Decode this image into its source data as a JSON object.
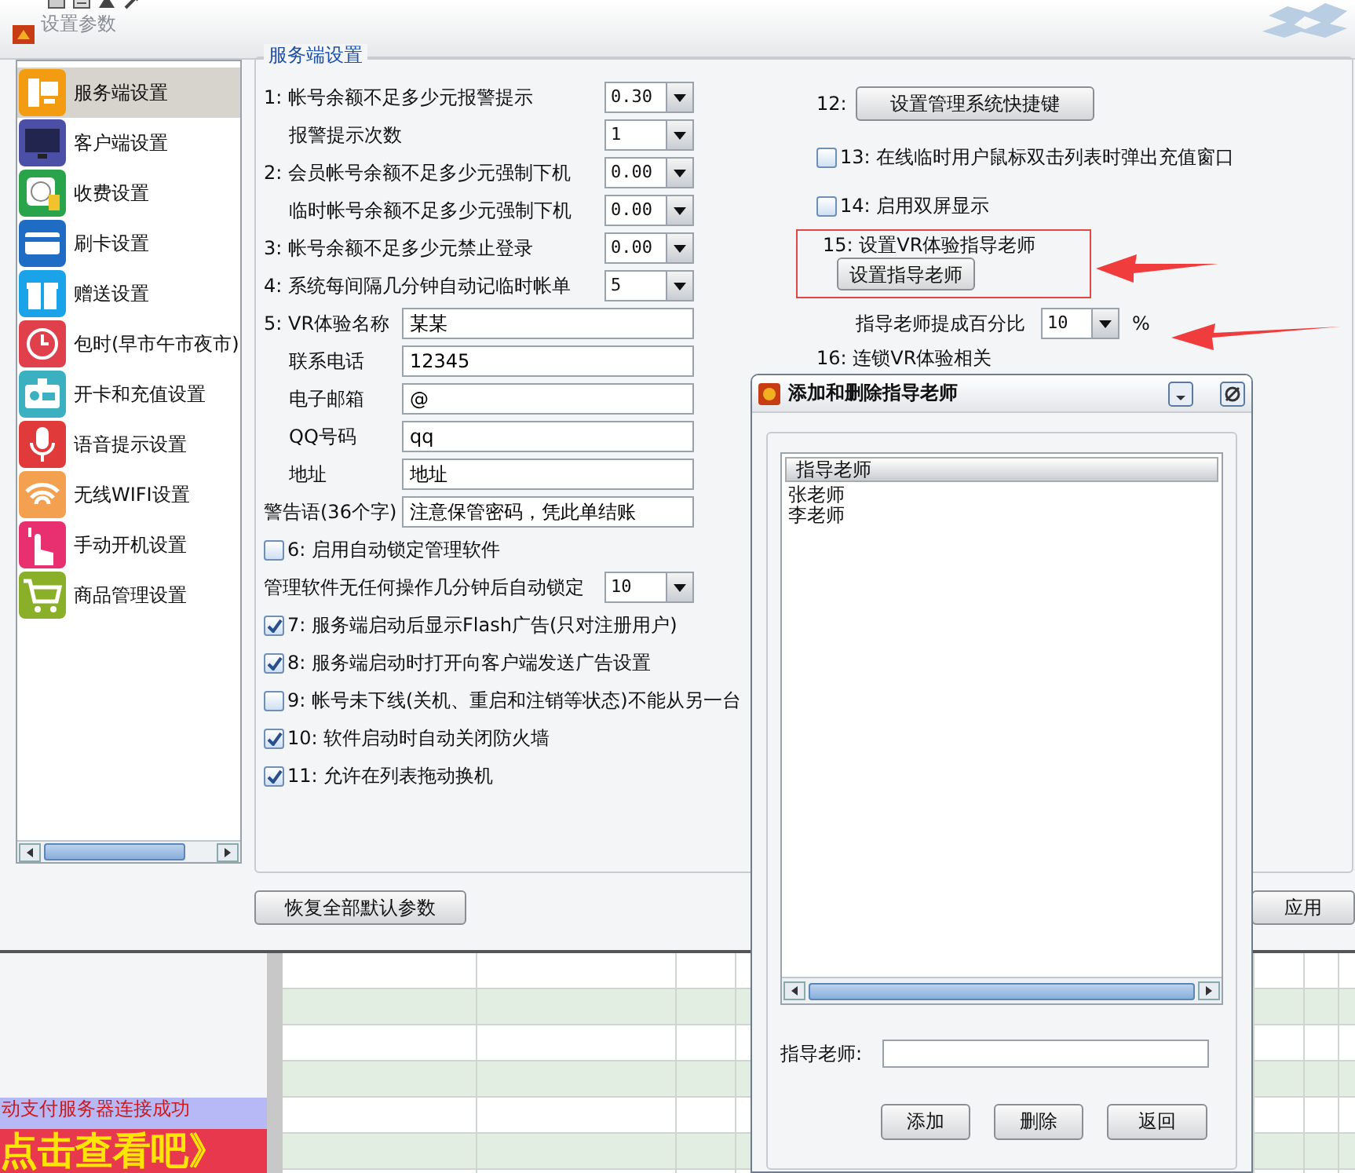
{
  "window": {
    "title": "设置参数"
  },
  "sidebar": {
    "items": [
      {
        "label": "服务端设置",
        "selected": true
      },
      {
        "label": "客户端设置",
        "selected": false
      },
      {
        "label": "收费设置",
        "selected": false
      },
      {
        "label": "刷卡设置",
        "selected": false
      },
      {
        "label": "赠送设置",
        "selected": false
      },
      {
        "label": "包时(早市午市夜市)",
        "selected": false
      },
      {
        "label": "开卡和充值设置",
        "selected": false
      },
      {
        "label": "语音提示设置",
        "selected": false
      },
      {
        "label": "无线WIFI设置",
        "selected": false
      },
      {
        "label": "手动开机设置",
        "selected": false
      },
      {
        "label": "商品管理设置",
        "selected": false
      }
    ]
  },
  "group": {
    "title": "服务端设置"
  },
  "left_rows": [
    {
      "kind": "select",
      "label": "1: 帐号余额不足多少元报警提示",
      "value": "0.30",
      "indented": false
    },
    {
      "kind": "select",
      "label": "报警提示次数",
      "value": "1",
      "indented": true
    },
    {
      "kind": "select",
      "label": "2: 会员帐号余额不足多少元强制下机",
      "value": "0.00",
      "indented": false
    },
    {
      "kind": "select",
      "label": "临时帐号余额不足多少元强制下机",
      "value": "0.00",
      "indented": true
    },
    {
      "kind": "select",
      "label": "3: 帐号余额不足多少元禁止登录",
      "value": "0.00",
      "indented": false
    },
    {
      "kind": "select",
      "label": "4: 系统每间隔几分钟自动记临时帐单",
      "value": "5",
      "indented": false
    },
    {
      "kind": "text",
      "label": "5: VR体验名称",
      "value": "某某",
      "indented": false
    },
    {
      "kind": "text",
      "label": "联系电话",
      "value": "12345",
      "indented": true
    },
    {
      "kind": "text",
      "label": "电子邮箱",
      "value": "@",
      "indented": true
    },
    {
      "kind": "text",
      "label": "QQ号码",
      "value": "qq",
      "indented": true
    },
    {
      "kind": "text",
      "label": "地址",
      "value": "地址",
      "indented": true
    },
    {
      "kind": "text",
      "label": "警告语(36个字)",
      "value": "注意保管密码，凭此单结账",
      "indented": false
    },
    {
      "kind": "checkbox",
      "label": "6: 启用自动锁定管理软件",
      "checked": false
    },
    {
      "kind": "select",
      "label": "管理软件无任何操作几分钟后自动锁定",
      "value": "10",
      "indented": false
    },
    {
      "kind": "checkbox",
      "label": "7: 服务端启动后显示Flash广告(只对注册用户)",
      "checked": true
    },
    {
      "kind": "checkbox",
      "label": "8: 服务端启动时打开向客户端发送广告设置",
      "checked": true
    },
    {
      "kind": "checkbox",
      "label": "9: 帐号未下线(关机、重启和注销等状态)不能从另一台",
      "checked": false
    },
    {
      "kind": "checkbox",
      "label": "10: 软件启动时自动关闭防火墙",
      "checked": true
    },
    {
      "kind": "checkbox",
      "label": "11: 允许在列表拖动换机",
      "checked": true
    }
  ],
  "right_rows": [
    {
      "kind": "button",
      "label": "12:",
      "button": "设置管理系统快捷键"
    },
    {
      "kind": "checkbox",
      "label": "13: 在线临时用户鼠标双击列表时弹出充值窗口",
      "checked": false
    },
    {
      "kind": "checkbox",
      "label": "14: 启用双屏显示",
      "checked": false
    },
    {
      "kind": "highlight",
      "label": "15: 设置VR体验指导老师",
      "button": "设置指导老师"
    },
    {
      "kind": "select",
      "label": "指导老师提成百分比",
      "value": "10",
      "suffix": "%"
    },
    {
      "kind": "label",
      "label": "16: 连锁VR体验相关"
    }
  ],
  "footer_buttons": [
    "恢复全部默认参数",
    "应用"
  ],
  "dialog": {
    "title": "添加和删除指导老师",
    "list": {
      "header": "指导老师",
      "items": [
        "张老师",
        "李老师"
      ]
    },
    "field": {
      "label": "指导老师:"
    },
    "buttons": [
      "添加",
      "删除",
      "返回"
    ]
  },
  "status": {
    "message": "动支付服务器连接成功",
    "banner": "点击查看吧》"
  }
}
